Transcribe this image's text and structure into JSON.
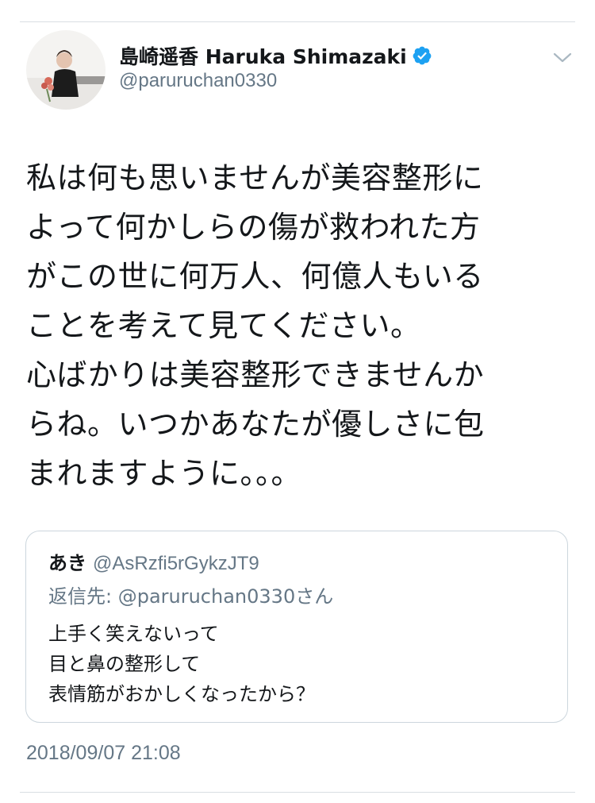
{
  "author": {
    "display_name": "島崎遥香 Haruka Shimazaki",
    "handle": "@paruruchan0330",
    "verified": true,
    "verified_color": "#1da1f2"
  },
  "tweet": {
    "lines": [
      "私は何も思いませんが美容整形に",
      "よって何かしらの傷が救われた方",
      "がこの世に何万人、何億人もいる",
      "ことを考えて見てください。",
      "心ばかりは美容整形できませんか",
      "らね。いつかあなたが優しさに包",
      "まれますように。。。"
    ],
    "timestamp": "2018/09/07 21:08"
  },
  "quoted": {
    "name": "あき",
    "handle": "@AsRzfi5rGykzJT9",
    "reply_to": "返信先: @paruruchan0330さん",
    "lines": [
      "上手く笑えないって",
      "目と鼻の整形して",
      "表情筋がおかしくなったから？"
    ]
  },
  "icons": {
    "menu": "chevron-down-icon",
    "verified": "verified-badge-icon"
  },
  "colors": {
    "text": "#14171a",
    "secondary": "#657786",
    "border": "#ccd6dd"
  }
}
